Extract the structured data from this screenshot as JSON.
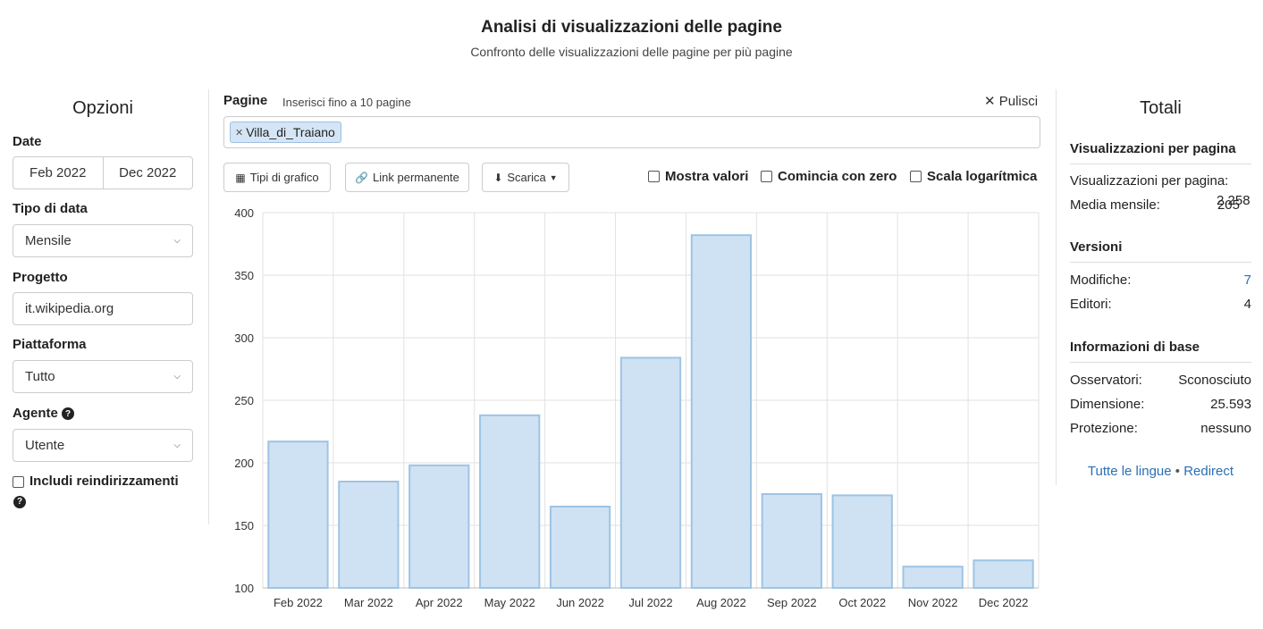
{
  "header": {
    "title": "Analisi di visualizzazioni delle pagine",
    "subtitle": "Confronto delle visualizzazioni delle pagine per più pagine"
  },
  "options": {
    "title": "Opzioni",
    "date_label": "Date",
    "date_start": "Feb 2022",
    "date_end": "Dec 2022",
    "date_type_label": "Tipo di data",
    "date_type_value": "Mensile",
    "project_label": "Progetto",
    "project_value": "it.wikipedia.org",
    "platform_label": "Piattaforma",
    "platform_value": "Tutto",
    "agent_label": "Agente",
    "agent_value": "Utente",
    "redirects_label": "Includi reindirizzamenti"
  },
  "pages": {
    "label": "Pagine",
    "hint": "Inserisci fino a 10 pagine",
    "clear_label": "Pulisci",
    "tags": [
      "Villa_di_Traiano"
    ]
  },
  "toolbar": {
    "chart_types": "Tipi di grafico",
    "permalink": "Link permanente",
    "download": "Scarica",
    "show_values": "Mostra valori",
    "start_zero": "Comincia con zero",
    "log_scale": "Scala logarítmica"
  },
  "totals": {
    "title": "Totali",
    "views_section": "Visualizzazioni per pagina",
    "views_label": "Visualizzazioni per pagina:",
    "monthly_avg_label": "Media mensile:",
    "monthly_avg_value": "205",
    "views_value": "2.258",
    "versions_section": "Versioni",
    "edits_label": "Modifiche:",
    "edits_value": "7",
    "editors_label": "Editori:",
    "editors_value": "4",
    "basic_info_section": "Informazioni di base",
    "watchers_label": "Osservatori:",
    "watchers_value": "Sconosciuto",
    "size_label": "Dimensione:",
    "size_value": "25.593",
    "protection_label": "Protezione:",
    "protection_value": "nessuno",
    "all_languages": "Tutte le lingue",
    "separator": "•",
    "redirects": "Redirect"
  },
  "colors": {
    "bar_fill": "#cfe2f3",
    "bar_stroke": "#9fc3e4",
    "link": "#2a6fb5"
  },
  "chart_data": {
    "type": "bar",
    "categories": [
      "Feb 2022",
      "Mar 2022",
      "Apr 2022",
      "May 2022",
      "Jun 2022",
      "Jul 2022",
      "Aug 2022",
      "Sep 2022",
      "Oct 2022",
      "Nov 2022",
      "Dec 2022"
    ],
    "values": [
      217,
      185,
      198,
      238,
      165,
      284,
      382,
      175,
      174,
      117,
      122
    ],
    "ylim": [
      100,
      400
    ],
    "yticks": [
      100,
      150,
      200,
      250,
      300,
      350,
      400
    ],
    "grid": true,
    "title": "",
    "xlabel": "",
    "ylabel": ""
  }
}
